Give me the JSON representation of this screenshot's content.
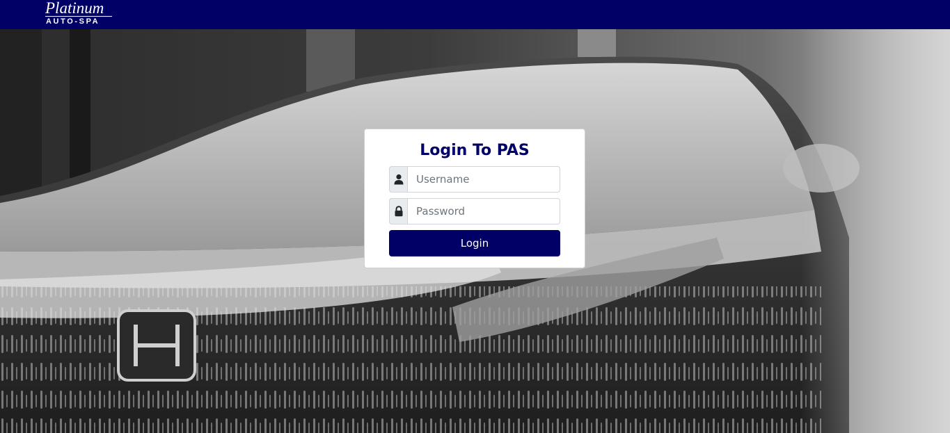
{
  "header": {
    "logo": {
      "script_text": "Platinum",
      "sub_text": "AUTO-SPA"
    },
    "background_color": "#000066"
  },
  "hero": {
    "background_image": "foam-covered-car-grayscale"
  },
  "login": {
    "title": "Login To PAS",
    "username": {
      "placeholder": "Username",
      "value": "",
      "icon": "user-icon"
    },
    "password": {
      "placeholder": "Password",
      "value": "",
      "icon": "lock-icon"
    },
    "button_label": "Login",
    "accent_color": "#000066"
  }
}
